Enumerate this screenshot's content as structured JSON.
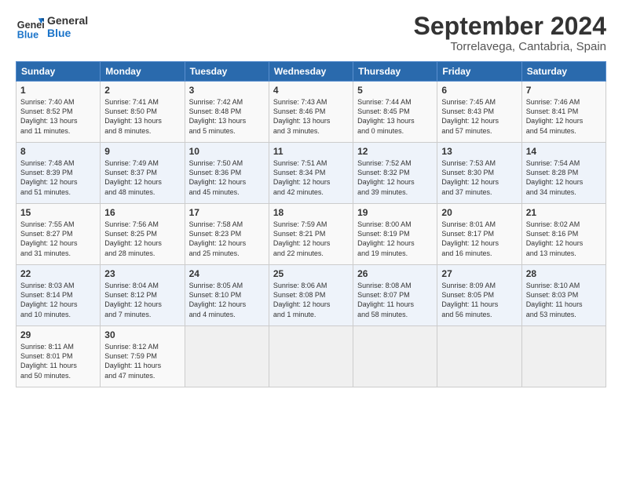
{
  "header": {
    "logo_text_general": "General",
    "logo_text_blue": "Blue",
    "month_title": "September 2024",
    "location": "Torrelavega, Cantabria, Spain"
  },
  "calendar": {
    "days_of_week": [
      "Sunday",
      "Monday",
      "Tuesday",
      "Wednesday",
      "Thursday",
      "Friday",
      "Saturday"
    ],
    "weeks": [
      [
        {
          "day": "",
          "content": ""
        },
        {
          "day": "2",
          "content": "Sunrise: 7:41 AM\nSunset: 8:50 PM\nDaylight: 13 hours\nand 8 minutes."
        },
        {
          "day": "3",
          "content": "Sunrise: 7:42 AM\nSunset: 8:48 PM\nDaylight: 13 hours\nand 5 minutes."
        },
        {
          "day": "4",
          "content": "Sunrise: 7:43 AM\nSunset: 8:46 PM\nDaylight: 13 hours\nand 3 minutes."
        },
        {
          "day": "5",
          "content": "Sunrise: 7:44 AM\nSunset: 8:45 PM\nDaylight: 13 hours\nand 0 minutes."
        },
        {
          "day": "6",
          "content": "Sunrise: 7:45 AM\nSunset: 8:43 PM\nDaylight: 12 hours\nand 57 minutes."
        },
        {
          "day": "7",
          "content": "Sunrise: 7:46 AM\nSunset: 8:41 PM\nDaylight: 12 hours\nand 54 minutes."
        }
      ],
      [
        {
          "day": "8",
          "content": "Sunrise: 7:48 AM\nSunset: 8:39 PM\nDaylight: 12 hours\nand 51 minutes."
        },
        {
          "day": "9",
          "content": "Sunrise: 7:49 AM\nSunset: 8:37 PM\nDaylight: 12 hours\nand 48 minutes."
        },
        {
          "day": "10",
          "content": "Sunrise: 7:50 AM\nSunset: 8:36 PM\nDaylight: 12 hours\nand 45 minutes."
        },
        {
          "day": "11",
          "content": "Sunrise: 7:51 AM\nSunset: 8:34 PM\nDaylight: 12 hours\nand 42 minutes."
        },
        {
          "day": "12",
          "content": "Sunrise: 7:52 AM\nSunset: 8:32 PM\nDaylight: 12 hours\nand 39 minutes."
        },
        {
          "day": "13",
          "content": "Sunrise: 7:53 AM\nSunset: 8:30 PM\nDaylight: 12 hours\nand 37 minutes."
        },
        {
          "day": "14",
          "content": "Sunrise: 7:54 AM\nSunset: 8:28 PM\nDaylight: 12 hours\nand 34 minutes."
        }
      ],
      [
        {
          "day": "15",
          "content": "Sunrise: 7:55 AM\nSunset: 8:27 PM\nDaylight: 12 hours\nand 31 minutes."
        },
        {
          "day": "16",
          "content": "Sunrise: 7:56 AM\nSunset: 8:25 PM\nDaylight: 12 hours\nand 28 minutes."
        },
        {
          "day": "17",
          "content": "Sunrise: 7:58 AM\nSunset: 8:23 PM\nDaylight: 12 hours\nand 25 minutes."
        },
        {
          "day": "18",
          "content": "Sunrise: 7:59 AM\nSunset: 8:21 PM\nDaylight: 12 hours\nand 22 minutes."
        },
        {
          "day": "19",
          "content": "Sunrise: 8:00 AM\nSunset: 8:19 PM\nDaylight: 12 hours\nand 19 minutes."
        },
        {
          "day": "20",
          "content": "Sunrise: 8:01 AM\nSunset: 8:17 PM\nDaylight: 12 hours\nand 16 minutes."
        },
        {
          "day": "21",
          "content": "Sunrise: 8:02 AM\nSunset: 8:16 PM\nDaylight: 12 hours\nand 13 minutes."
        }
      ],
      [
        {
          "day": "22",
          "content": "Sunrise: 8:03 AM\nSunset: 8:14 PM\nDaylight: 12 hours\nand 10 minutes."
        },
        {
          "day": "23",
          "content": "Sunrise: 8:04 AM\nSunset: 8:12 PM\nDaylight: 12 hours\nand 7 minutes."
        },
        {
          "day": "24",
          "content": "Sunrise: 8:05 AM\nSunset: 8:10 PM\nDaylight: 12 hours\nand 4 minutes."
        },
        {
          "day": "25",
          "content": "Sunrise: 8:06 AM\nSunset: 8:08 PM\nDaylight: 12 hours\nand 1 minute."
        },
        {
          "day": "26",
          "content": "Sunrise: 8:08 AM\nSunset: 8:07 PM\nDaylight: 11 hours\nand 58 minutes."
        },
        {
          "day": "27",
          "content": "Sunrise: 8:09 AM\nSunset: 8:05 PM\nDaylight: 11 hours\nand 56 minutes."
        },
        {
          "day": "28",
          "content": "Sunrise: 8:10 AM\nSunset: 8:03 PM\nDaylight: 11 hours\nand 53 minutes."
        }
      ],
      [
        {
          "day": "29",
          "content": "Sunrise: 8:11 AM\nSunset: 8:01 PM\nDaylight: 11 hours\nand 50 minutes."
        },
        {
          "day": "30",
          "content": "Sunrise: 8:12 AM\nSunset: 7:59 PM\nDaylight: 11 hours\nand 47 minutes."
        },
        {
          "day": "",
          "content": ""
        },
        {
          "day": "",
          "content": ""
        },
        {
          "day": "",
          "content": ""
        },
        {
          "day": "",
          "content": ""
        },
        {
          "day": "",
          "content": ""
        }
      ]
    ],
    "week0_day1": {
      "day": "1",
      "content": "Sunrise: 7:40 AM\nSunset: 8:52 PM\nDaylight: 13 hours\nand 11 minutes."
    }
  }
}
